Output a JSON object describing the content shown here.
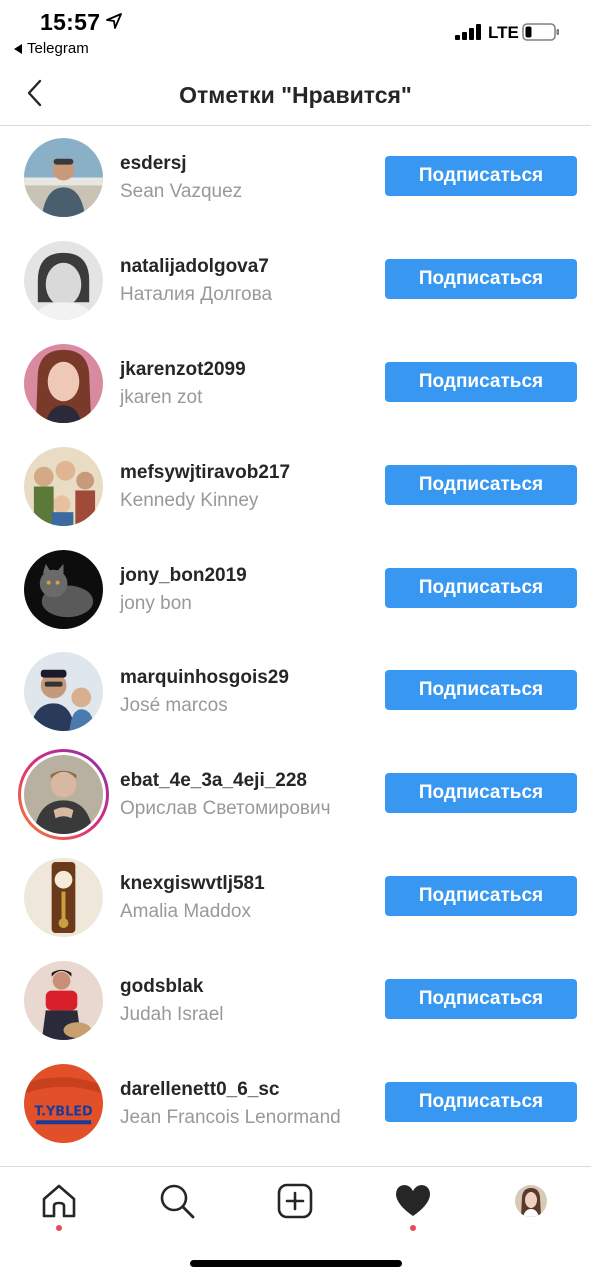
{
  "status_bar": {
    "time": "15:57",
    "back_app": "Telegram",
    "network": "LTE"
  },
  "header": {
    "title": "Отметки \"Нравится\""
  },
  "follow_label": "Подписаться",
  "users": [
    {
      "username": "esdersj",
      "full_name": "Sean Vazquez"
    },
    {
      "username": "natalijadolgova7",
      "full_name": "Наталия Долгова"
    },
    {
      "username": "jkarenzot2099",
      "full_name": "jkaren zot"
    },
    {
      "username": "mefsywjtiravob217",
      "full_name": "Kennedy Kinney"
    },
    {
      "username": "jony_bon2019",
      "full_name": "jony bon"
    },
    {
      "username": "marquinhosgois29",
      "full_name": "José marcos"
    },
    {
      "username": "ebat_4e_3a_4eji_228",
      "full_name": "Орислав Светомирович"
    },
    {
      "username": "knexgiswvtlj581",
      "full_name": "Amalia Maddox"
    },
    {
      "username": "godsblak",
      "full_name": "Judah Israel"
    },
    {
      "username": "darellenett0_6_sc",
      "full_name": "Jean Francois Lenormand"
    }
  ],
  "avatar_texts": {
    "last_avatar_logo": "T.YBLED"
  },
  "colors": {
    "follow_button": "#3897f0",
    "secondary_text": "#999999",
    "notification_dot": "#ed4956"
  },
  "tabs": [
    "home-icon",
    "search-icon",
    "add-post-icon",
    "activity-heart-icon",
    "profile-avatar"
  ]
}
